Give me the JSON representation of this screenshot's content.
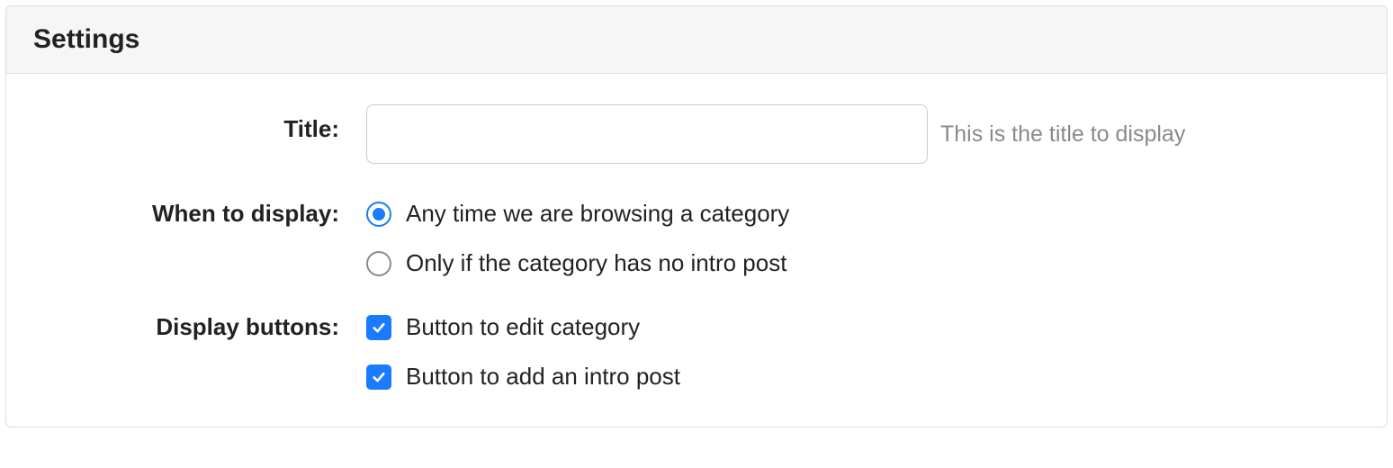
{
  "panel": {
    "title": "Settings"
  },
  "fields": {
    "title": {
      "label": "Title:",
      "value": "",
      "hint": "This is the title to display"
    },
    "when_to_display": {
      "label": "When to display:",
      "options": [
        {
          "label": "Any time we are browsing a category",
          "checked": true
        },
        {
          "label": "Only if the category has no intro post",
          "checked": false
        }
      ]
    },
    "display_buttons": {
      "label": "Display buttons:",
      "options": [
        {
          "label": "Button to edit category",
          "checked": true
        },
        {
          "label": "Button to add an intro post",
          "checked": true
        }
      ]
    }
  }
}
